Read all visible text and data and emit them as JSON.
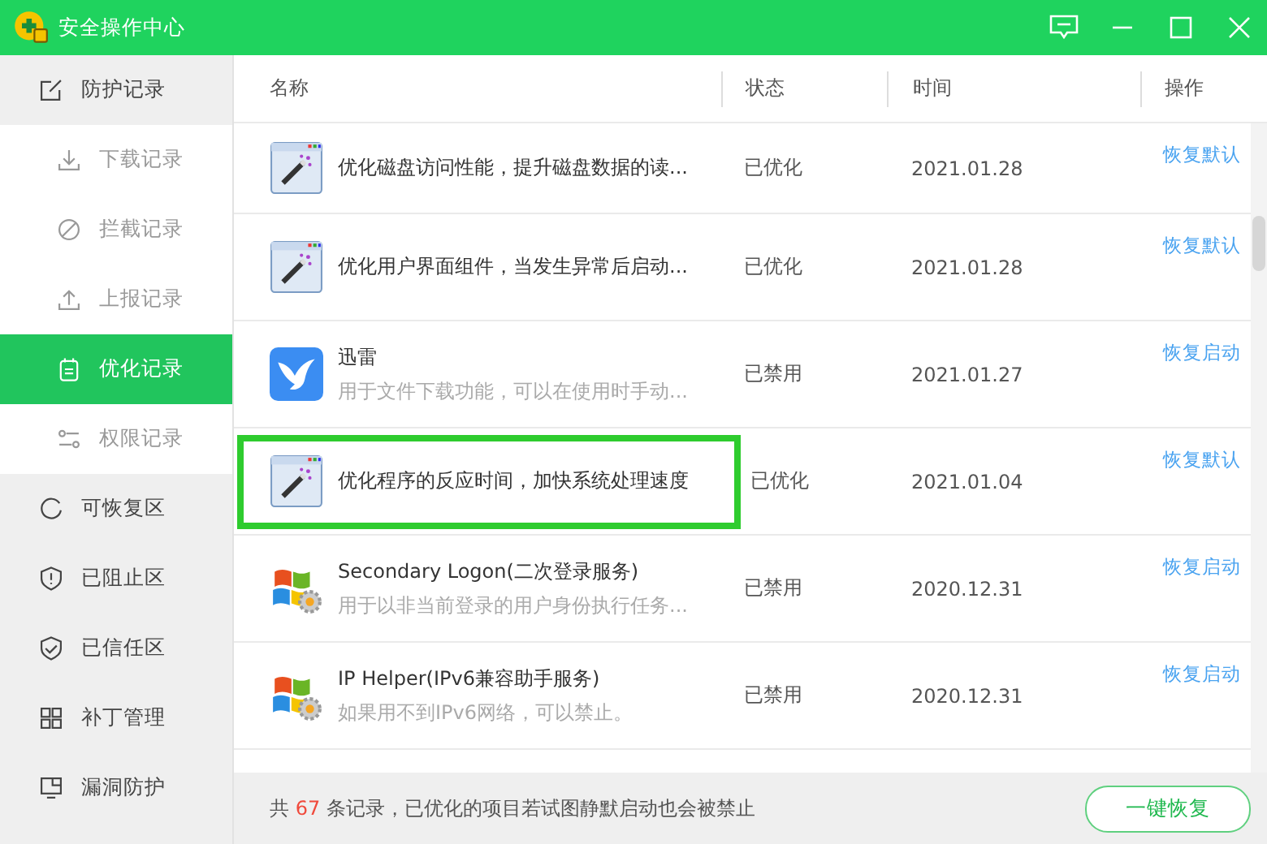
{
  "window": {
    "title": "安全操作中心"
  },
  "sidebar": {
    "items": [
      {
        "label": "防护记录",
        "kind": "group",
        "selected": false,
        "children": [
          {
            "label": "下载记录",
            "selected": false
          },
          {
            "label": "拦截记录",
            "selected": false
          },
          {
            "label": "上报记录",
            "selected": false
          },
          {
            "label": "优化记录",
            "selected": true
          },
          {
            "label": "权限记录",
            "selected": false
          }
        ]
      },
      {
        "label": "可恢复区",
        "kind": "item",
        "selected": false
      },
      {
        "label": "已阻止区",
        "kind": "item",
        "selected": false
      },
      {
        "label": "已信任区",
        "kind": "item",
        "selected": false
      },
      {
        "label": "补丁管理",
        "kind": "item",
        "selected": false
      },
      {
        "label": "漏洞防护",
        "kind": "item",
        "selected": false
      }
    ]
  },
  "table": {
    "columns": [
      "名称",
      "状态",
      "时间",
      "操作"
    ],
    "rows": [
      {
        "kind": "wand",
        "name": "优化磁盘访问性能，提升磁盘数据的读...",
        "status": "已优化",
        "time": "2021.01.28",
        "action": "恢复默认",
        "highlighted": false
      },
      {
        "kind": "wand",
        "name": "优化用户界面组件，当发生异常后启动...",
        "status": "已优化",
        "time": "2021.01.28",
        "action": "恢复默认",
        "highlighted": false
      },
      {
        "kind": "bird",
        "name": "迅雷",
        "description": "用于文件下载功能，可以在使用时手动...",
        "status": "已禁用",
        "time": "2021.01.27",
        "action": "恢复启动",
        "highlighted": false
      },
      {
        "kind": "wand",
        "name": "优化程序的反应时间，加快系统处理速度",
        "status": "已优化",
        "time": "2021.01.04",
        "action": "恢复默认",
        "highlighted": true
      },
      {
        "kind": "windows",
        "name": "Secondary Logon(二次登录服务)",
        "description": "用于以非当前登录的用户身份执行任务...",
        "status": "已禁用",
        "time": "2020.12.31",
        "action": "恢复启动",
        "highlighted": false
      },
      {
        "kind": "windows",
        "name": "IP Helper(IPv6兼容助手服务)",
        "description": "如果用不到IPv6网络，可以禁止。",
        "status": "已禁用",
        "time": "2020.12.31",
        "action": "恢复启动",
        "highlighted": false
      }
    ]
  },
  "footer": {
    "prefix": "共",
    "count": "67",
    "suffix": "条记录，已优化的项目若试图静默启动也会被禁止",
    "button": "一键恢复"
  }
}
